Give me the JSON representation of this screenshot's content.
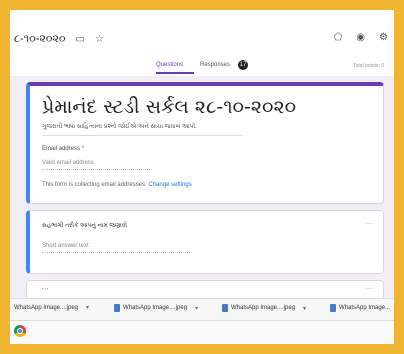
{
  "header": {
    "doc_title": "૮-૧૦-૨૦૨૦",
    "folder_icon": "folder-icon",
    "star_icon": "star-icon",
    "palette_icon": "palette-icon",
    "preview_icon": "eye-icon",
    "settings_icon": "gear-icon"
  },
  "tabs": {
    "questions": "Questions",
    "responses": "Responses",
    "responses_count": "17",
    "total_points": "Total points: 0"
  },
  "form": {
    "title": "પ્રેમાનંદ સ્ટડી સર્કલ ૨૮-૧૦-૨૦૨૦",
    "description": "ગુજરાતી ભાષા સાહિત્યના પ્રશ્નો જોઈએ અને સાચા જવાબ આપો.",
    "email_label": "Email address",
    "email_required": "*",
    "email_placeholder": "Valid email address",
    "collect_note": "This form is collecting email addresses.",
    "collect_link": "Change settings"
  },
  "question": {
    "title": "સહભાગી તરીકે આપનું નામ જણાવો",
    "placeholder": "Short answer text"
  },
  "downloads": [
    {
      "name": "WhatsApp Image....jpeg"
    },
    {
      "name": "WhatsApp Image....jpeg"
    },
    {
      "name": "WhatsApp Image....jpeg"
    },
    {
      "name": "WhatsApp Image..."
    }
  ],
  "colors": {
    "accent": "#673ab7",
    "focus": "#4285f4",
    "frame": "#f0b52e"
  }
}
